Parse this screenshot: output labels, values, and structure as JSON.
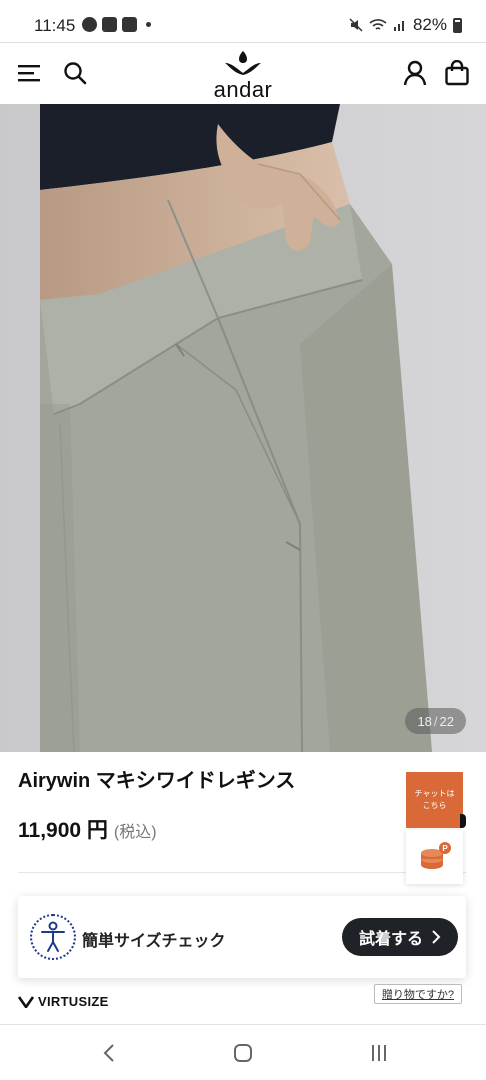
{
  "status_bar": {
    "time": "11:45",
    "battery": "82%",
    "left_icons": [
      "line-app-icon",
      "gallery-icon",
      "news-icon"
    ],
    "right_icons": [
      "mute-icon",
      "wifi-icon",
      "signal-icon",
      "battery-icon"
    ]
  },
  "header": {
    "logo_text": "andar",
    "icons": [
      "menu-icon",
      "search-icon",
      "user-icon",
      "shopping-bag-icon"
    ]
  },
  "gallery": {
    "current": "18",
    "separator": "/",
    "total": "22"
  },
  "product": {
    "name": "Airywin マキシワイドレギンス",
    "price": "11,900 円",
    "tax_note": "(税込)"
  },
  "side_widgets": {
    "chat_label": "チャットは こちら",
    "points_icon": "coins-icon"
  },
  "virtusize": {
    "label": "簡単サイズチェック",
    "try_button": "試着する",
    "brand": "VIRTUSIZE",
    "gift_link": "贈り物ですか?"
  },
  "colors": {
    "accent_orange": "#d96a38",
    "button_dark": "#1f2226",
    "virtusize_blue": "#1e3a8a"
  },
  "nav": {
    "icons": [
      "back-icon",
      "home-icon",
      "recents-icon"
    ]
  }
}
